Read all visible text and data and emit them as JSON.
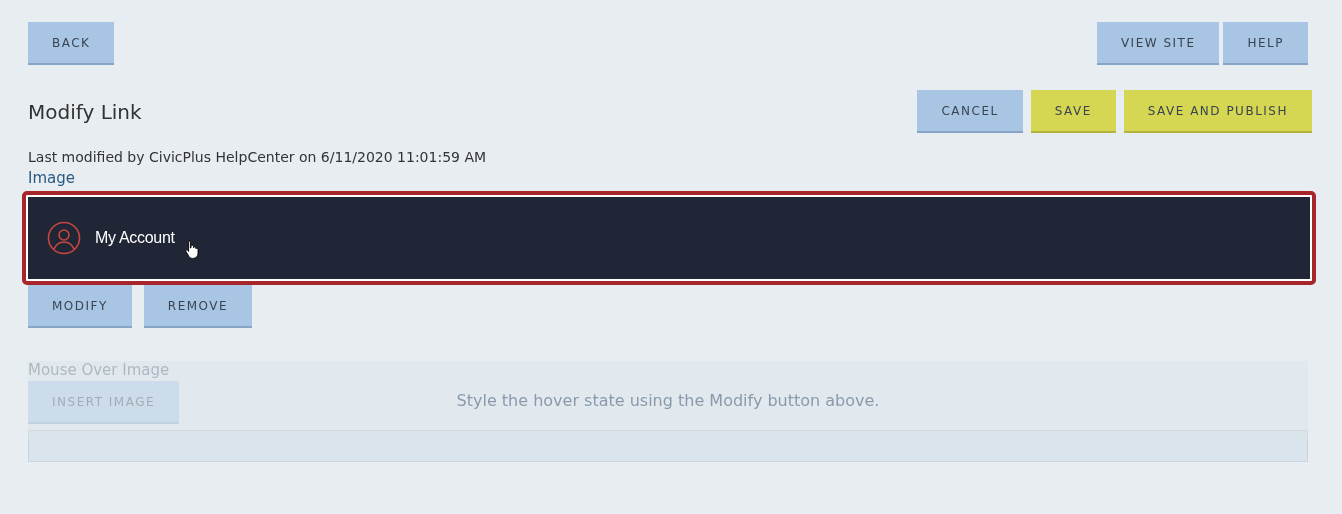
{
  "top_bar": {
    "left_buttons": [
      {
        "label": "BACK",
        "kind": "secondary"
      }
    ],
    "right_buttons": [
      {
        "label": "VIEW SITE",
        "kind": "secondary"
      },
      {
        "label": "HELP",
        "kind": "secondary"
      }
    ]
  },
  "header": {
    "title": "Modify Link",
    "actions": [
      {
        "label": "CANCEL",
        "kind": "secondary"
      },
      {
        "label": "SAVE",
        "kind": "accent"
      },
      {
        "label": "SAVE AND PUBLISH",
        "kind": "accent"
      }
    ]
  },
  "last_modified": "Last modified by CivicPlus HelpCenter on 6/11/2020 11:01:59 AM",
  "image_section": {
    "label": "Image",
    "preview": {
      "text": "My Account",
      "selected": true,
      "hovered": true
    },
    "buttons": [
      {
        "label": "MODIFY",
        "kind": "secondary"
      },
      {
        "label": "REMOVE",
        "kind": "secondary"
      }
    ]
  },
  "mouse_over_section": {
    "label": "Mouse Over Image",
    "button": "INSERT IMAGE",
    "disabled": true,
    "overlay_message": "Style the hover state using the Modify button above."
  }
}
